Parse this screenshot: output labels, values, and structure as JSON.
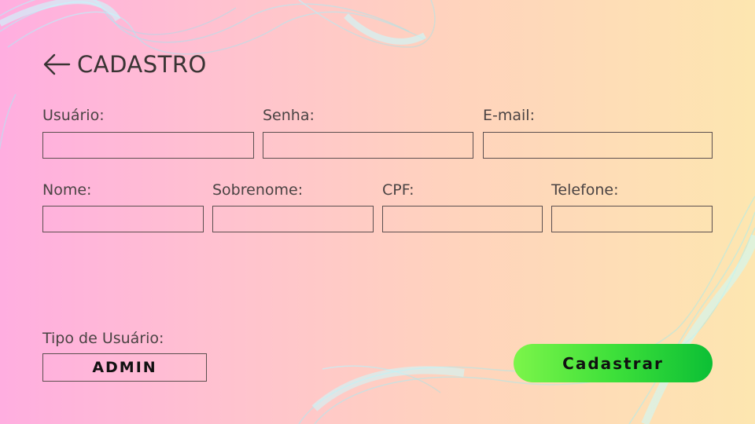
{
  "header": {
    "title": "CADASTRO",
    "back_icon": "arrow-left-icon"
  },
  "form": {
    "row1": [
      {
        "label": "Usuário:",
        "value": ""
      },
      {
        "label": "Senha:",
        "value": ""
      },
      {
        "label": "E-mail:",
        "value": ""
      }
    ],
    "row2": [
      {
        "label": "Nome:",
        "value": ""
      },
      {
        "label": "Sobrenome:",
        "value": ""
      },
      {
        "label": "CPF:",
        "value": ""
      },
      {
        "label": "Telefone:",
        "value": ""
      }
    ]
  },
  "user_type": {
    "label": "Tipo de Usuário:",
    "value": "ADMIN"
  },
  "submit": {
    "label": "Cadastrar"
  },
  "colors": {
    "accent_green": "#3ee03a",
    "text": "#3a3434"
  }
}
